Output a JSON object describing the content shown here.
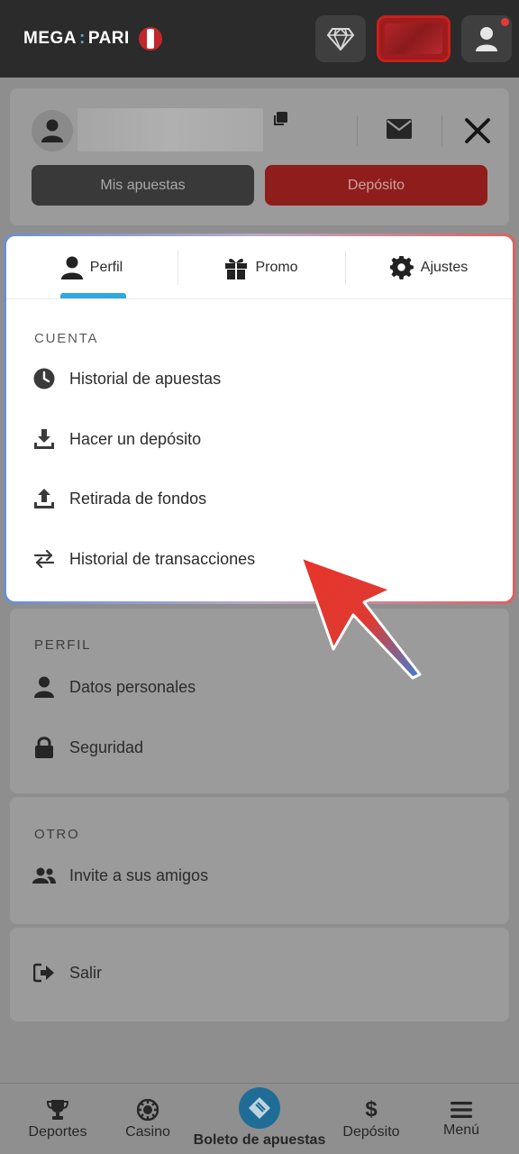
{
  "header": {
    "logo_left": "MEGA",
    "logo_right": "PARI",
    "icons": [
      "diamond-icon",
      "user-icon"
    ],
    "has_notification": true
  },
  "account": {
    "mis_apuestas_label": "Mis apuestas",
    "deposito_label": "Depósito"
  },
  "tabs": [
    {
      "label": "Perfil",
      "icon": "person-icon",
      "active": true
    },
    {
      "label": "Promo",
      "icon": "gift-icon"
    },
    {
      "label": "Ajustes",
      "icon": "gear-icon"
    }
  ],
  "cuenta": {
    "title": "CUENTA",
    "items": [
      {
        "label": "Historial de apuestas",
        "icon": "clock-icon"
      },
      {
        "label": "Hacer un depósito",
        "icon": "download-icon"
      },
      {
        "label": "Retirada de fondos",
        "icon": "upload-icon"
      },
      {
        "label": "Historial de transacciones",
        "icon": "transfer-icon"
      }
    ]
  },
  "perfil": {
    "title": "PERFIL",
    "items": [
      {
        "label": "Datos personales",
        "icon": "person-icon"
      },
      {
        "label": "Seguridad",
        "icon": "lock-icon"
      }
    ]
  },
  "otro": {
    "title": "OTRO",
    "items": [
      {
        "label": "Invite a sus amigos",
        "icon": "people-icon"
      }
    ]
  },
  "salir": {
    "label": "Salir",
    "icon": "logout-icon"
  },
  "bottom_nav": [
    {
      "label": "Deportes",
      "icon": "trophy-icon"
    },
    {
      "label": "Casino",
      "icon": "chip-icon"
    },
    {
      "label": "Boleto de apuestas",
      "icon": "ticket-icon"
    },
    {
      "label": "Depósito",
      "icon": "dollar-icon"
    },
    {
      "label": "Menú",
      "icon": "hamburger-icon"
    }
  ],
  "colors": {
    "accent_red": "#c8211e",
    "accent_blue": "#2ea8e0",
    "header_bg": "#2b2b2b"
  }
}
